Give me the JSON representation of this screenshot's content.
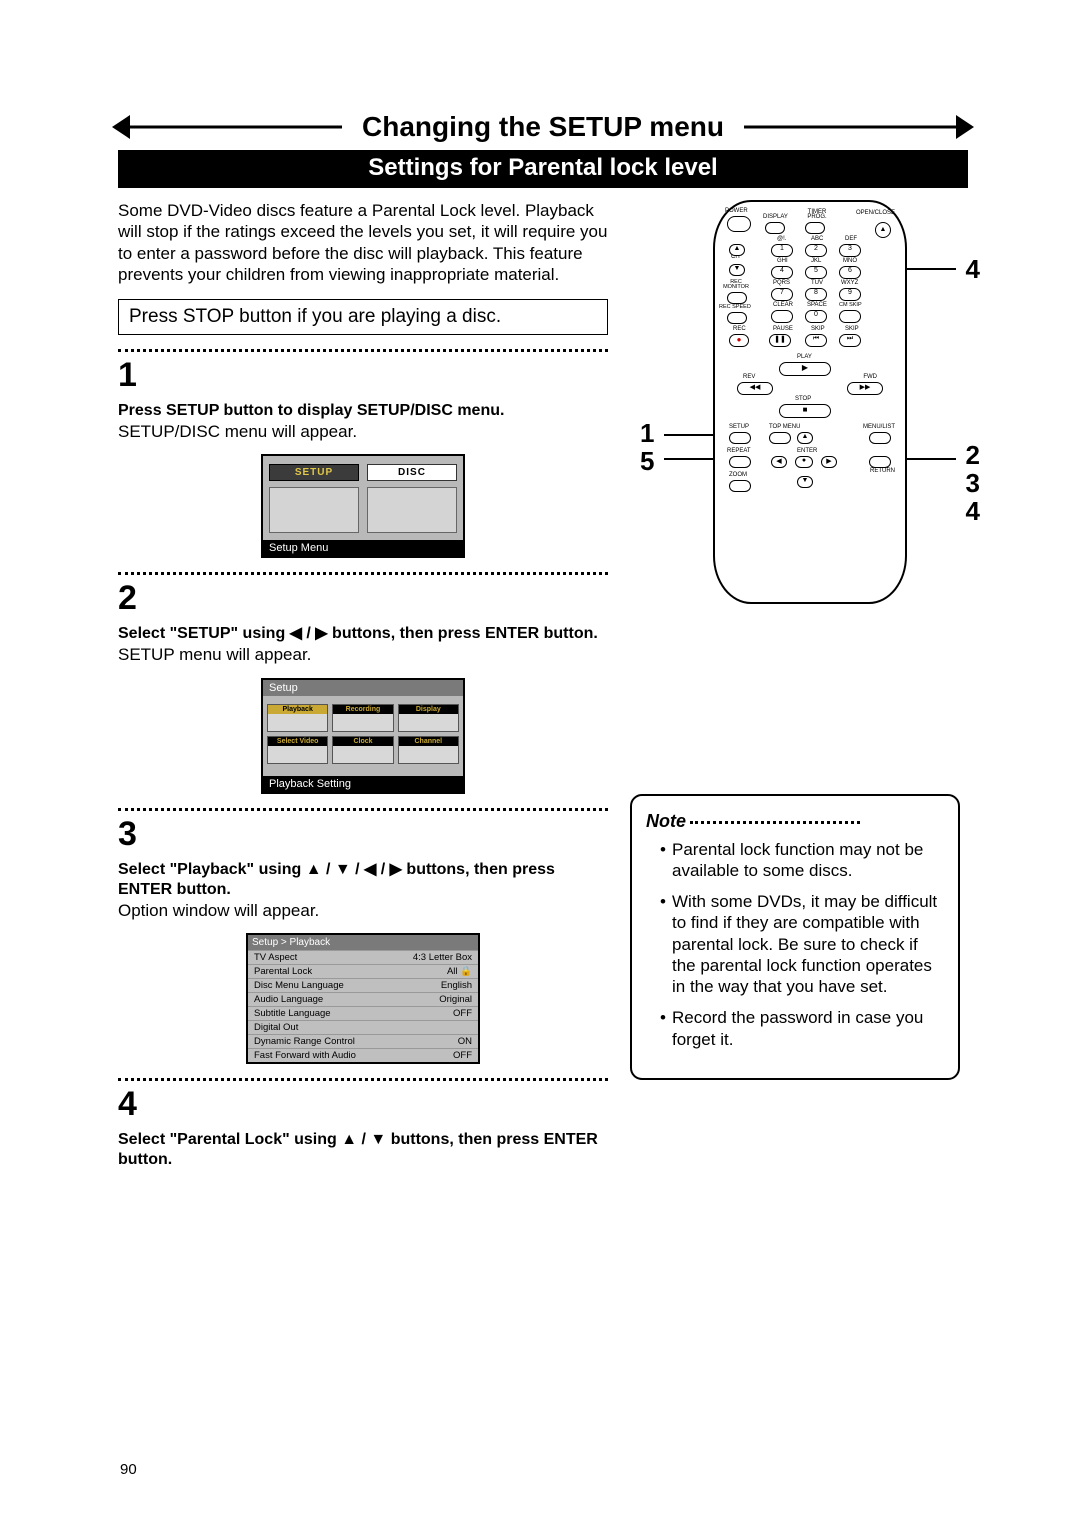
{
  "header": {
    "title": "Changing the SETUP menu",
    "subtitle": "Settings for Parental lock level"
  },
  "intro": "Some DVD-Video discs feature a Parental Lock level. Playback will stop if the ratings exceed the levels you set, it will require you to enter a password before the disc will playback. This feature prevents your children from viewing inappropriate material.",
  "box_instruction": "Press STOP button if you are playing a disc.",
  "steps": {
    "s1": {
      "num": "1",
      "bold": "Press SETUP button to display SETUP/DISC menu.",
      "plain": "SETUP/DISC menu will appear.",
      "screen_top": "",
      "tab_setup": "SETUP",
      "tab_disc": "DISC",
      "caption": "Setup Menu"
    },
    "s2": {
      "num": "2",
      "bold": "Select \"SETUP\" using ◀ / ▶ buttons, then press ENTER button.",
      "plain": "SETUP menu will appear.",
      "screen_top": "Setup",
      "cells": {
        "c0": "Playback",
        "c1": "Recording",
        "c2": "Display",
        "c3": "Select Video",
        "c4": "Clock",
        "c5": "Channel"
      },
      "caption": "Playback Setting"
    },
    "s3": {
      "num": "3",
      "bold": "Select \"Playback\" using ▲ / ▼ / ◀ / ▶ buttons, then press ENTER button.",
      "plain": "Option window will appear.",
      "screen_top": "Setup > Playback",
      "rows": {
        "r0k": "TV Aspect",
        "r0v": "4:3 Letter Box",
        "r1k": "Parental Lock",
        "r1v": "All   🔒",
        "r2k": "Disc Menu Language",
        "r2v": "English",
        "r3k": "Audio Language",
        "r3v": "Original",
        "r4k": "Subtitle Language",
        "r4v": "OFF",
        "r5k": "Digital Out",
        "r5v": "",
        "r6k": "Dynamic Range Control",
        "r6v": "ON",
        "r7k": "Fast Forward with Audio",
        "r7v": "OFF"
      }
    },
    "s4": {
      "num": "4",
      "bold": "Select \"Parental Lock\" using ▲ / ▼ buttons, then press ENTER button."
    }
  },
  "remote": {
    "labels": {
      "power": "POWER",
      "display": "DISPLAY",
      "timer": "TIMER PROG.",
      "open": "OPEN/CLOSE",
      "at": "@!.",
      "abc": "ABC",
      "def": "DEF",
      "ch": "CH",
      "ghi": "GHI",
      "jkl": "JKL",
      "mno": "MNO",
      "rec_mon": "REC MONITOR",
      "pqrs": "PQRS",
      "tuv": "TUV",
      "wxyz": "WXYZ",
      "rec_speed": "REC SPEED",
      "clear": "CLEAR",
      "space": "SPACE",
      "cmskip": "CM SKIP",
      "rec": "REC",
      "pause": "PAUSE",
      "skip_l": "SKIP",
      "skip_r": "SKIP",
      "play": "PLAY",
      "rev": "REV",
      "fwd": "FWD",
      "stop": "STOP",
      "setup": "SETUP",
      "topmenu": "TOP MENU",
      "menulist": "MENU/LIST",
      "repeat": "REPEAT",
      "enter": "ENTER",
      "return": "RETURN",
      "zoom": "ZOOM"
    },
    "keypad": {
      "k1": "1",
      "k2": "2",
      "k3": "3",
      "k4": "4",
      "k5": "5",
      "k6": "6",
      "k7": "7",
      "k8": "8",
      "k9": "9",
      "k0": "0"
    },
    "callouts": {
      "left_top": "1",
      "left_bot": "5",
      "right_top": "4",
      "right_1": "2",
      "right_2": "3",
      "right_3": "4"
    }
  },
  "note": {
    "title": "Note",
    "items": {
      "n0": "Parental lock function may not be available to some discs.",
      "n1": "With some DVDs, it may be difficult to find if they are compatible with parental lock. Be sure to check if the parental lock function operates in the way that you have set.",
      "n2": "Record the password in case you forget it."
    }
  },
  "page_number": "90"
}
